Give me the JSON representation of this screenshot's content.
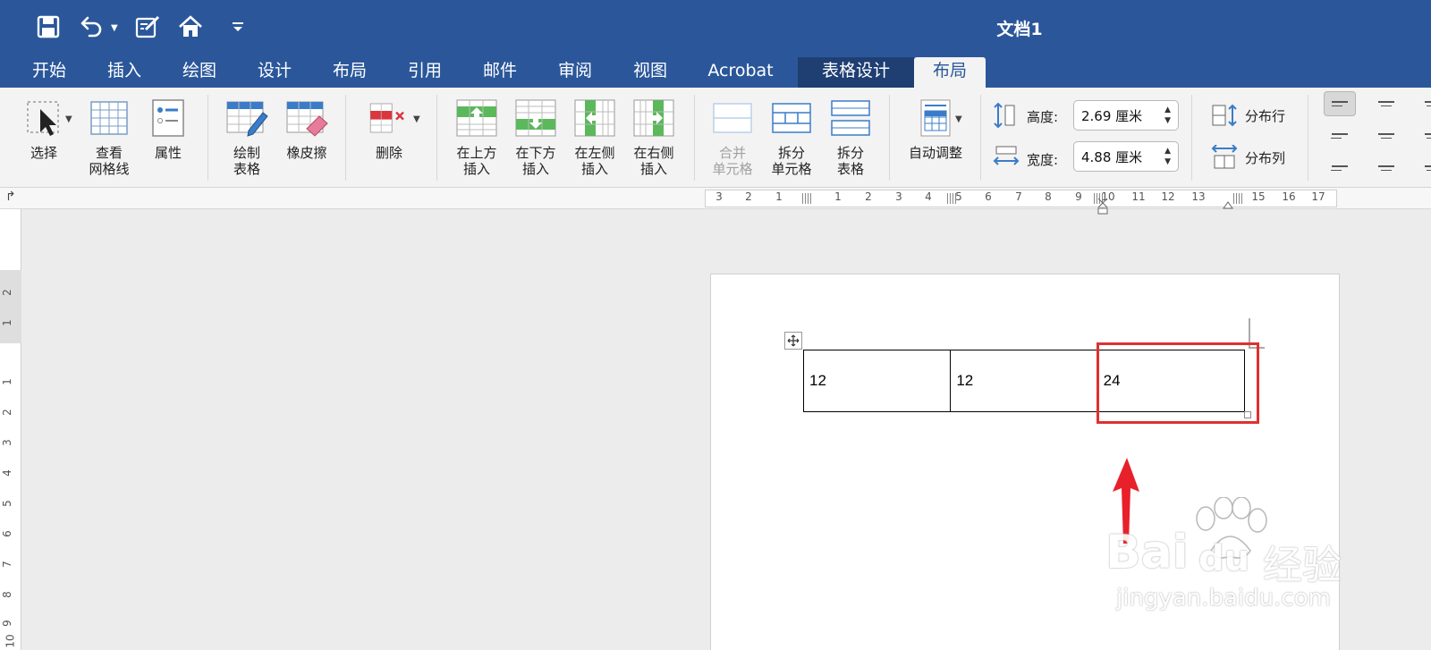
{
  "titlebar": {
    "title": "文档1",
    "icons": [
      "save-icon",
      "undo-icon",
      "edit-icon",
      "home-icon",
      "customize-icon"
    ]
  },
  "tabs": [
    {
      "label": "开始"
    },
    {
      "label": "插入"
    },
    {
      "label": "绘图"
    },
    {
      "label": "设计"
    },
    {
      "label": "布局"
    },
    {
      "label": "引用"
    },
    {
      "label": "邮件"
    },
    {
      "label": "审阅"
    },
    {
      "label": "视图"
    },
    {
      "label": "Acrobat"
    },
    {
      "label": "表格设计"
    },
    {
      "label": "布局"
    }
  ],
  "ribbon": {
    "select": "选择",
    "view_grid_line1": "查看",
    "view_grid_line2": "网格线",
    "properties": "属性",
    "draw_table_line1": "绘制",
    "draw_table_line2": "表格",
    "eraser": "橡皮擦",
    "delete": "删除",
    "insert_above_line1": "在上方",
    "insert_above_line2": "插入",
    "insert_below_line1": "在下方",
    "insert_below_line2": "插入",
    "insert_left_line1": "在左侧",
    "insert_left_line2": "插入",
    "insert_right_line1": "在右侧",
    "insert_right_line2": "插入",
    "merge_line1": "合并",
    "merge_line2": "单元格",
    "split_cells_line1": "拆分",
    "split_cells_line2": "单元格",
    "split_table_line1": "拆分",
    "split_table_line2": "表格",
    "autofit": "自动调整",
    "height_label": "高度:",
    "height_value": "2.69 厘米",
    "width_label": "宽度:",
    "width_value": "4.88 厘米",
    "distribute_rows": "分布行",
    "distribute_cols": "分布列"
  },
  "ruler": {
    "h_numbers": [
      "3",
      "2",
      "1",
      "1",
      "2",
      "3",
      "4",
      "5",
      "6",
      "7",
      "8",
      "9",
      "10",
      "11",
      "12",
      "13",
      "15",
      "16",
      "17"
    ],
    "v_numbers": [
      "2",
      "1",
      "1",
      "2",
      "3",
      "4",
      "5",
      "6",
      "7",
      "8",
      "9",
      "10"
    ]
  },
  "table": {
    "rows": [
      [
        "12",
        "12",
        "24"
      ]
    ]
  },
  "watermark": {
    "brand": "Bai",
    "brand2": "du",
    "cn": "经验",
    "url": "jingyan.baidu.com"
  },
  "colors": {
    "titlebar": "#2b579a",
    "highlight": "#e03030",
    "arrow": "#e8202a"
  }
}
